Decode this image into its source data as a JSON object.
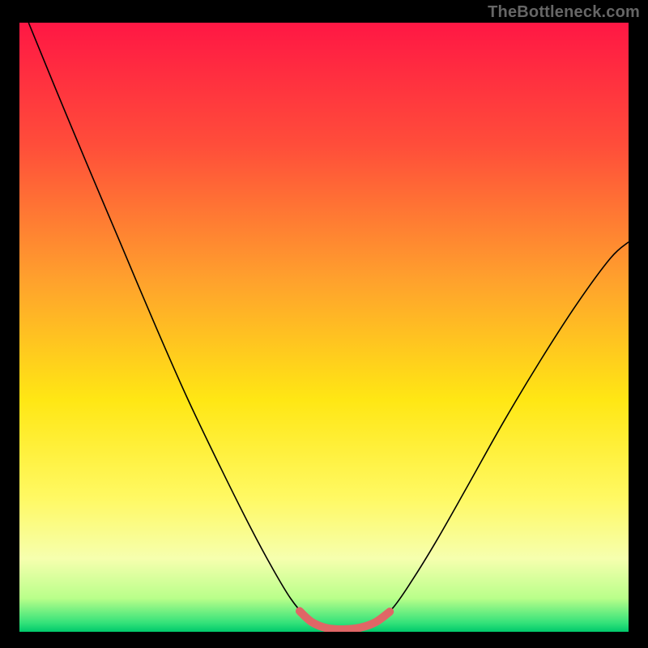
{
  "watermark": "TheBottleneck.com",
  "chart_data": {
    "type": "line",
    "title": "",
    "xlabel": "",
    "ylabel": "",
    "xlim": [
      0,
      1
    ],
    "ylim": [
      0,
      1
    ],
    "gradient_stops": [
      {
        "offset": 0.0,
        "color": "#ff1744"
      },
      {
        "offset": 0.2,
        "color": "#ff4d3a"
      },
      {
        "offset": 0.42,
        "color": "#ffa02d"
      },
      {
        "offset": 0.62,
        "color": "#ffe714"
      },
      {
        "offset": 0.78,
        "color": "#fff963"
      },
      {
        "offset": 0.88,
        "color": "#f6ffae"
      },
      {
        "offset": 0.945,
        "color": "#b9ff8a"
      },
      {
        "offset": 0.985,
        "color": "#35e27a"
      },
      {
        "offset": 1.0,
        "color": "#00c96b"
      }
    ],
    "series": [
      {
        "name": "bottleneck-curve",
        "color": "#000000",
        "width": 1.6,
        "points": [
          {
            "x": 0.015,
            "y": 1.0
          },
          {
            "x": 0.06,
            "y": 0.89
          },
          {
            "x": 0.11,
            "y": 0.77
          },
          {
            "x": 0.165,
            "y": 0.64
          },
          {
            "x": 0.22,
            "y": 0.51
          },
          {
            "x": 0.275,
            "y": 0.385
          },
          {
            "x": 0.33,
            "y": 0.27
          },
          {
            "x": 0.38,
            "y": 0.17
          },
          {
            "x": 0.415,
            "y": 0.105
          },
          {
            "x": 0.445,
            "y": 0.055
          },
          {
            "x": 0.47,
            "y": 0.025
          },
          {
            "x": 0.495,
            "y": 0.008
          },
          {
            "x": 0.525,
            "y": 0.003
          },
          {
            "x": 0.555,
            "y": 0.004
          },
          {
            "x": 0.582,
            "y": 0.013
          },
          {
            "x": 0.612,
            "y": 0.038
          },
          {
            "x": 0.645,
            "y": 0.085
          },
          {
            "x": 0.685,
            "y": 0.15
          },
          {
            "x": 0.735,
            "y": 0.238
          },
          {
            "x": 0.795,
            "y": 0.345
          },
          {
            "x": 0.855,
            "y": 0.445
          },
          {
            "x": 0.915,
            "y": 0.538
          },
          {
            "x": 0.97,
            "y": 0.613
          },
          {
            "x": 1.0,
            "y": 0.64
          }
        ]
      },
      {
        "name": "optimal-band",
        "color": "#e06666",
        "width": 10,
        "linecap": "round",
        "points": [
          {
            "x": 0.46,
            "y": 0.034
          },
          {
            "x": 0.48,
            "y": 0.016
          },
          {
            "x": 0.505,
            "y": 0.006
          },
          {
            "x": 0.532,
            "y": 0.004
          },
          {
            "x": 0.56,
            "y": 0.007
          },
          {
            "x": 0.585,
            "y": 0.016
          },
          {
            "x": 0.608,
            "y": 0.033
          }
        ]
      }
    ]
  }
}
